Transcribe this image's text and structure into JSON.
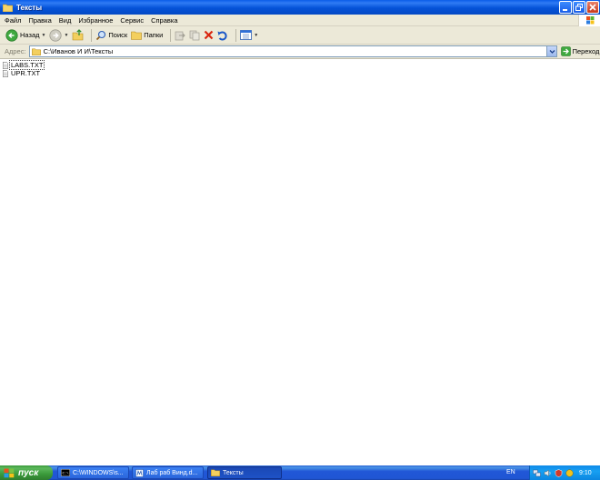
{
  "window": {
    "title": "Тексты"
  },
  "menu": {
    "items": [
      "Файл",
      "Правка",
      "Вид",
      "Избранное",
      "Сервис",
      "Справка"
    ]
  },
  "toolbar": {
    "back_label": "Назад",
    "search_label": "Поиск",
    "folders_label": "Папки"
  },
  "address": {
    "label": "Адрес:",
    "path": "C:\\Иванов И И\\Тексты",
    "go_label": "Переход"
  },
  "files": [
    {
      "name": "LABS.TXT",
      "selected": true
    },
    {
      "name": "UPR.TXT",
      "selected": false
    }
  ],
  "taskbar": {
    "start_label": "пуск",
    "tasks": [
      {
        "label": "C:\\WINDOWS\\s...",
        "icon": "console-icon",
        "active": false
      },
      {
        "label": "Лаб раб Винд.d...",
        "icon": "word-document-icon",
        "active": false
      },
      {
        "label": "Тексты",
        "icon": "folder-icon",
        "active": true
      }
    ],
    "language": "EN",
    "clock": "9:10"
  },
  "colors": {
    "titlebar": "#0553d8",
    "chrome": "#ece9d8",
    "taskbar": "#2157d7",
    "start": "#3a9a3a",
    "tray": "#17a0f2"
  }
}
